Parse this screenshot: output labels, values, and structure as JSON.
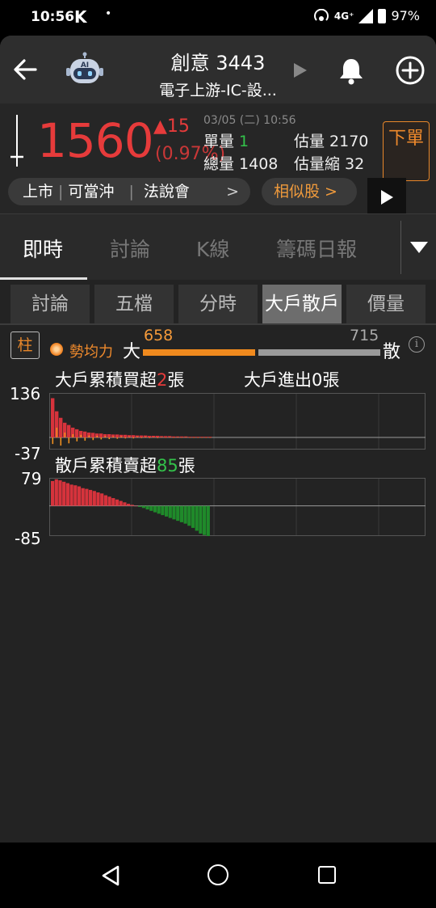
{
  "status": {
    "time": "10:56",
    "app_glyph": "K",
    "dot": "•",
    "network": "4G⁺",
    "battery": "97%"
  },
  "header": {
    "title": "創意 3443",
    "subtitle": "電子上游-IC-設...",
    "icons": {
      "back": "arrow-left-icon",
      "ai": "ai-robot-icon",
      "bell": "bell-icon",
      "add": "plus-circle-icon",
      "play": "play-icon"
    }
  },
  "quote": {
    "price": "1560",
    "change": "▲15",
    "change_pct": "(0.97%)",
    "date": "03/05 (二) 10:56",
    "single_volume_label": "單量",
    "single_volume": "1",
    "total_volume_label": "總量",
    "total_volume": "1408",
    "est_volume_label": "估量",
    "est_volume": "2170",
    "est_shrink_label": "估量縮",
    "est_shrink": "32",
    "order_button": "下單",
    "tags": [
      "上市",
      "可當沖",
      "法說會"
    ],
    "similar_button": "相似股 >",
    "colors": {
      "up": "#e63b3b",
      "down": "#33c24a",
      "accent": "#ef8a2c"
    }
  },
  "main_tabs": [
    {
      "label": "即時",
      "active": true
    },
    {
      "label": "討論",
      "active": false
    },
    {
      "label": "K線",
      "active": false
    },
    {
      "label": "籌碼日報",
      "active": false
    }
  ],
  "sub_tabs": [
    {
      "label": "討論",
      "active": false
    },
    {
      "label": "五檔",
      "active": false
    },
    {
      "label": "分時",
      "active": false
    },
    {
      "label": "大戶散戶",
      "active": true
    },
    {
      "label": "價量",
      "active": false
    }
  ],
  "strength": {
    "toggle_label": "柱",
    "label": "勢均力",
    "big_char": "大",
    "small_char": "散",
    "big_value": "658",
    "small_value": "715",
    "info_glyph": "i"
  },
  "big_chart": {
    "title_prefix": "大戶累積買超",
    "title_value": "2",
    "title_suffix": "張",
    "flow_text": "大戶進出0張",
    "y_max": "136",
    "y_min": "-37"
  },
  "retail_chart": {
    "title_prefix": "散戶累積賣超",
    "title_value": "85",
    "title_suffix": "張",
    "y_max": "79",
    "y_min": "-85"
  },
  "chart_data": [
    {
      "type": "bar",
      "title": "大戶累積買超2張",
      "ylim": [
        -37,
        136
      ],
      "series": [
        {
          "values": [
            120,
            80,
            60,
            45,
            38,
            30,
            25,
            20,
            18,
            15,
            14,
            12,
            12,
            10,
            10,
            9,
            9,
            8,
            8,
            7,
            7,
            6,
            6,
            6,
            5,
            5,
            5,
            4,
            4,
            4,
            3,
            3,
            3,
            3,
            2,
            2,
            2,
            2,
            2,
            2
          ]
        },
        {
          "values": [
            -20,
            30,
            -25,
            15,
            -18,
            10,
            -12,
            8,
            -10,
            6,
            -8,
            5,
            -6,
            4,
            -5,
            3,
            -4,
            3,
            -3,
            2,
            -3,
            2,
            -2,
            2,
            -2,
            1,
            -2,
            1,
            -1,
            1,
            -1,
            1,
            -1,
            1,
            -1,
            0,
            -1,
            0,
            0,
            0
          ]
        }
      ],
      "colors": [
        "#d6333c",
        "#f09020"
      ]
    },
    {
      "type": "bar",
      "title": "散戶累積賣超85張",
      "ylim": [
        -85,
        79
      ],
      "values": [
        70,
        75,
        72,
        68,
        64,
        60,
        58,
        55,
        50,
        48,
        45,
        42,
        38,
        35,
        30,
        26,
        22,
        18,
        14,
        10,
        6,
        3,
        0,
        -3,
        -6,
        -10,
        -14,
        -18,
        -22,
        -26,
        -30,
        -34,
        -38,
        -42,
        -46,
        -50,
        -56,
        -62,
        -70,
        -78,
        -82,
        -85
      ],
      "colors": {
        "positive": "#d6333c",
        "negative": "#1f8a2a"
      }
    }
  ],
  "navbar": {
    "icons": [
      "nav-back-icon",
      "nav-home-icon",
      "nav-recent-icon"
    ]
  }
}
